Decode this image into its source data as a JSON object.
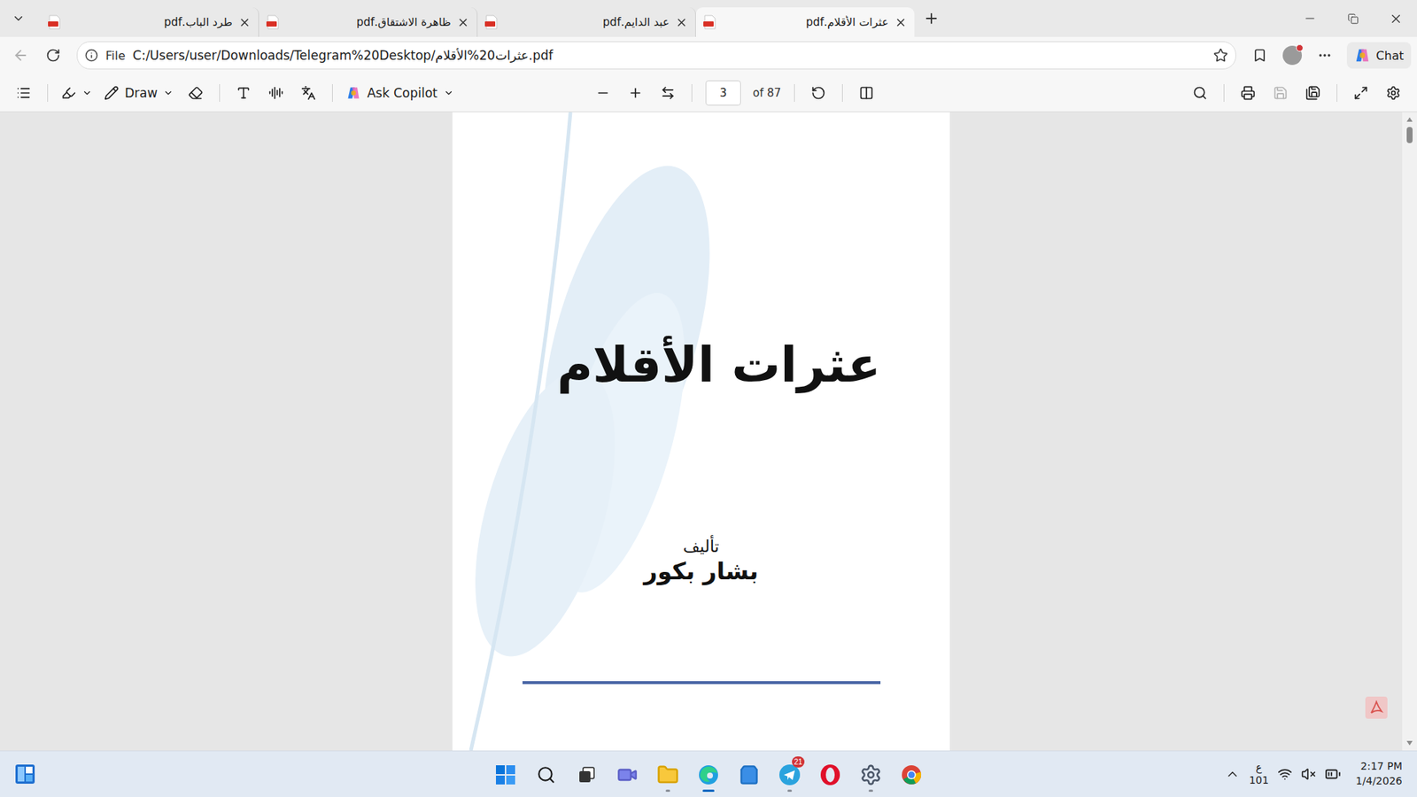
{
  "tabs": [
    {
      "label": "طرد الباب.pdf",
      "selected": false
    },
    {
      "label": "ظاهرة الاشتقاق.pdf",
      "selected": false
    },
    {
      "label": "عبد الدايم.pdf",
      "selected": false
    },
    {
      "label": "عثرات الأقلام.pdf",
      "selected": true
    }
  ],
  "address_bar": {
    "scheme": "File",
    "url": "C:/Users/user/Downloads/Telegram%20Desktop/عثرات20%الأقلام.pdf"
  },
  "profile": {
    "notification": true
  },
  "chat_button": {
    "label": "Chat"
  },
  "pdf_toolbar": {
    "draw": "Draw",
    "copilot": "Ask Copilot",
    "page": "3",
    "page_count": "of 87",
    "save_enabled": false
  },
  "document": {
    "title": "عثرات الأقلام",
    "byline": "تأليف",
    "author": "بشار بكور"
  },
  "scrollbar": {
    "level": 0.02
  },
  "taskbar": {
    "apps": [
      {
        "kind": "start",
        "open": false,
        "active": false,
        "badge": ""
      },
      {
        "kind": "search",
        "open": false,
        "active": false,
        "badge": ""
      },
      {
        "kind": "task-view",
        "open": false,
        "active": false,
        "badge": ""
      },
      {
        "kind": "teams",
        "open": false,
        "active": false,
        "badge": ""
      },
      {
        "kind": "explorer",
        "open": true,
        "active": false,
        "badge": ""
      },
      {
        "kind": "edge",
        "open": true,
        "active": true,
        "badge": ""
      },
      {
        "kind": "store",
        "open": false,
        "active": false,
        "badge": ""
      },
      {
        "kind": "telegram",
        "open": true,
        "active": false,
        "badge": "21"
      },
      {
        "kind": "opera",
        "open": false,
        "active": false,
        "badge": ""
      },
      {
        "kind": "settings",
        "open": true,
        "active": false,
        "badge": ""
      },
      {
        "kind": "chrome",
        "open": false,
        "active": false,
        "badge": ""
      }
    ],
    "tray": {
      "ime": "ع",
      "ime_layout": "101",
      "time": "2:17 PM",
      "date": "1/4/2026"
    }
  }
}
